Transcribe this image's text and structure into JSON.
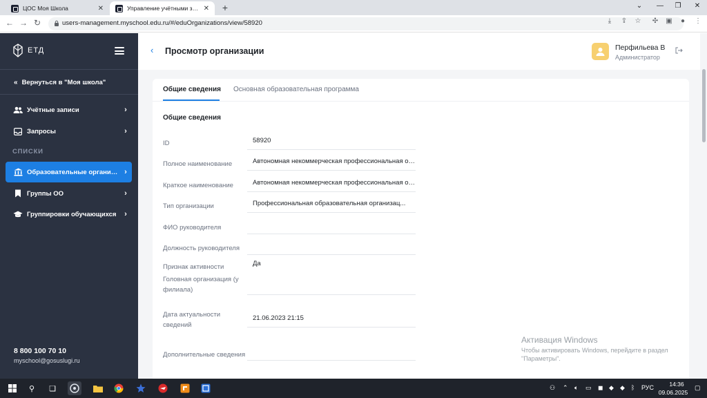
{
  "browser": {
    "tabs": [
      {
        "label": "ЦОС Моя Школа",
        "close": "✕"
      },
      {
        "label": "Управление учётными записями",
        "close": "✕"
      }
    ],
    "new_tab": "+",
    "window_controls": [
      "⌄",
      "—",
      "❐",
      "✕"
    ],
    "url": "users-management.myschool.edu.ru/#/eduOrganizations/view/58920"
  },
  "sidebar": {
    "logo_text": "ЕТД",
    "back_link": "Вернуться в \"Моя школа\"",
    "items": [
      {
        "label": "Учётные записи",
        "icon": "users-icon"
      },
      {
        "label": "Запросы",
        "icon": "inbox-icon"
      }
    ],
    "section_label": "СПИСКИ",
    "list_items": [
      {
        "label": "Образовательные организации",
        "icon": "institution-icon",
        "active": true
      },
      {
        "label": "Группы ОО",
        "icon": "bookmark-icon"
      },
      {
        "label": "Группировки обучающихся",
        "icon": "graduation-cap-icon"
      }
    ],
    "phone": "8 800 100 70 10",
    "email": "myschool@gosuslugi.ru"
  },
  "header": {
    "title": "Просмотр организации",
    "user_name": "Перфильева В",
    "user_role": "Администратор"
  },
  "card": {
    "tabs": [
      {
        "label": "Общие сведения",
        "active": true
      },
      {
        "label": "Основная образовательная программа",
        "active": false
      }
    ],
    "section_title": "Общие сведения",
    "fields": [
      {
        "label": "ID",
        "value": "58920"
      },
      {
        "label": "Полное наименование",
        "value": "Автономная некоммерческая профессиональная обр..."
      },
      {
        "label": "Краткое наименование",
        "value": "Автономная некоммерческая профессиональная обр..."
      },
      {
        "label": "Тип организации",
        "value": "Профессиональная образовательная организац..."
      },
      {
        "label": "ФИО руководителя",
        "value": ""
      },
      {
        "label": "Должность руководителя",
        "value": ""
      },
      {
        "label": "Признак активности",
        "value": "Да"
      },
      {
        "label": "Головная организация (у филиала)",
        "value": ""
      },
      {
        "label": "Дата актуальности сведений",
        "value": "21.06.2023 21:15"
      },
      {
        "label": "Дополнительные сведения",
        "value": ""
      }
    ]
  },
  "watermark": {
    "title": "Активация Windows",
    "subtitle": "Чтобы активировать Windows, перейдите в раздел \"Параметры\"."
  },
  "taskbar": {
    "language": "РУС",
    "time": "14:36",
    "date": "09.06.2025"
  },
  "colors": {
    "sidebar_bg": "#2b3241",
    "accent": "#1d7fe3",
    "avatar": "#f7d070",
    "main_bg": "#f4f5f7"
  }
}
